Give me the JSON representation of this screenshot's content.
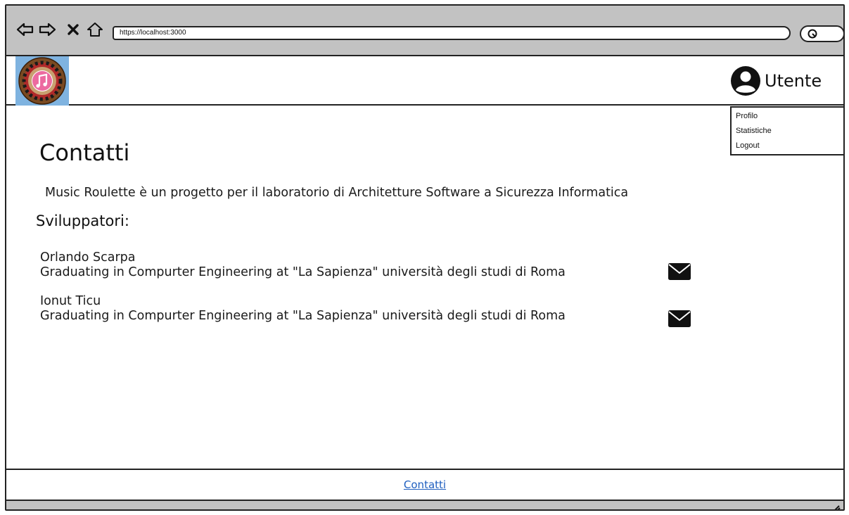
{
  "browser": {
    "url": "https://localhost:3000",
    "icons": [
      "back-arrow-icon",
      "forward-arrow-icon",
      "close-x-icon",
      "home-icon",
      "search-icon"
    ]
  },
  "header": {
    "logo_icon": "music-roulette-logo",
    "user": {
      "icon": "user-avatar-icon",
      "label": "Utente"
    },
    "user_menu": {
      "items": [
        "Profilo",
        "Statistiche",
        "Logout"
      ]
    }
  },
  "main": {
    "title": "Contatti",
    "description": "Music Roulette è un progetto per il laboratorio di Architetture Software a Sicurezza Informatica",
    "developers_heading": "Sviluppatori:",
    "developers": [
      {
        "name": "Orlando Scarpa",
        "bio": "Graduating in Compurter Engineering at \"La Sapienza\" università degli studi di Roma",
        "contact_icon": "envelope-icon"
      },
      {
        "name": "Ionut Ticu",
        "bio": "Graduating in Compurter Engineering at \"La Sapienza\" università degli studi di Roma",
        "contact_icon": "envelope-icon"
      }
    ]
  },
  "footer": {
    "link": "Contatti"
  },
  "colors": {
    "chrome": "#c2c2c2",
    "link": "#1f5fbf",
    "logo_bg": "#7fb3e0",
    "logo_wheel": "#7a4a22"
  }
}
